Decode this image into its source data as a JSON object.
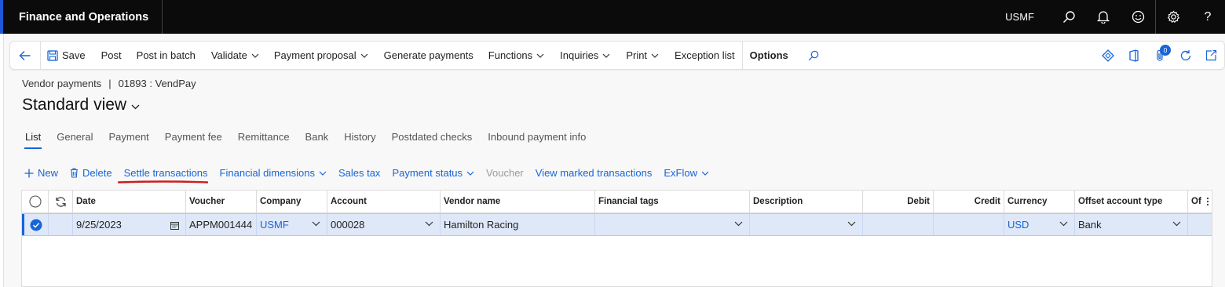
{
  "app": {
    "title": "Finance and Operations",
    "company": "USMF"
  },
  "appbar_icons": [
    "search-icon",
    "bell-icon",
    "smiley-icon",
    "gear-icon",
    "help-icon"
  ],
  "actionpane": {
    "save": "Save",
    "post": "Post",
    "post_batch": "Post in batch",
    "validate": "Validate",
    "payment_proposal": "Payment proposal",
    "generate_payments": "Generate payments",
    "functions": "Functions",
    "inquiries": "Inquiries",
    "print": "Print",
    "exception_list": "Exception list",
    "options": "Options",
    "badge_count": "0"
  },
  "breadcrumb": {
    "module": "Vendor payments",
    "separator": "|",
    "record": "01893 : VendPay"
  },
  "page": {
    "title": "Standard view"
  },
  "tabs": [
    "List",
    "General",
    "Payment",
    "Payment fee",
    "Remittance",
    "Bank",
    "History",
    "Postdated checks",
    "Inbound payment info"
  ],
  "gridbar": {
    "new": "New",
    "delete": "Delete",
    "settle": "Settle transactions",
    "financial_dimensions": "Financial dimensions",
    "sales_tax": "Sales tax",
    "payment_status": "Payment status",
    "voucher": "Voucher",
    "view_marked": "View marked transactions",
    "exflow": "ExFlow"
  },
  "grid": {
    "columns": {
      "date": "Date",
      "voucher": "Voucher",
      "company": "Company",
      "account": "Account",
      "vendor_name": "Vendor name",
      "financial_tags": "Financial tags",
      "description": "Description",
      "debit": "Debit",
      "credit": "Credit",
      "currency": "Currency",
      "offset_account_type": "Offset account type",
      "offset_truncated": "Of"
    },
    "row": {
      "date": "9/25/2023",
      "voucher": "APPM001444",
      "company": "USMF",
      "account": "000028",
      "vendor_name": "Hamilton Racing",
      "financial_tags": "",
      "description": "",
      "debit": "",
      "credit": "",
      "currency": "USD",
      "offset_account_type": "Bank"
    }
  },
  "colors": {
    "accent": "#1765d6",
    "appbar": "#0b0b0b",
    "highlight": "#dfe8f9",
    "annotation": "#d01c1c"
  }
}
